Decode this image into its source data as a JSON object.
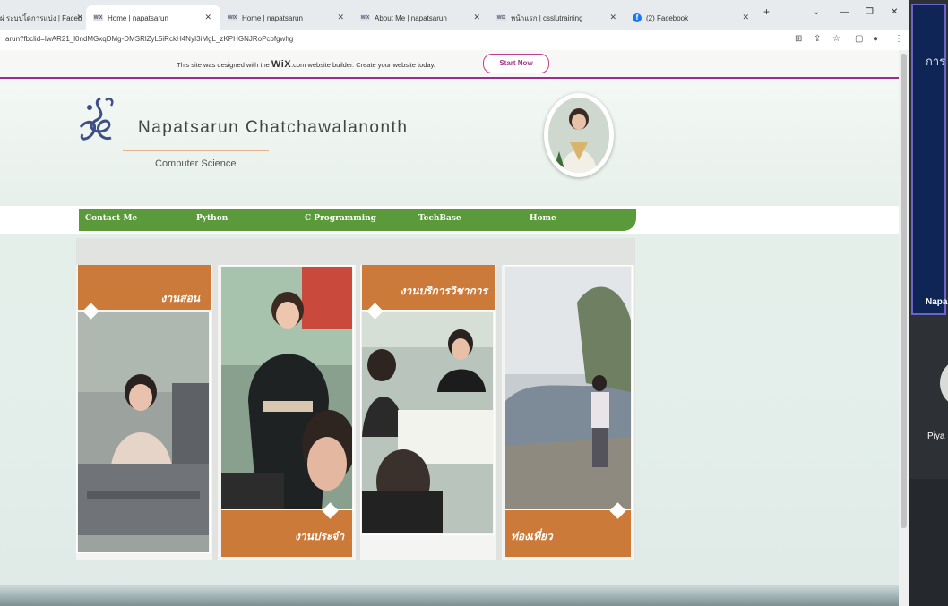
{
  "browser": {
    "tabs": [
      {
        "favicon": "",
        "title": "ผ่ ระบบไ้ดการแบ่ง | Faceb",
        "active": false
      },
      {
        "favicon": "WIX",
        "title": "Home | napatsarun",
        "active": true
      },
      {
        "favicon": "WIX",
        "title": "Home | napatsarun",
        "active": false
      },
      {
        "favicon": "WIX",
        "title": "About Me | napatsarun",
        "active": false
      },
      {
        "favicon": "WIX",
        "title": "หน้าแรก | csslutraining",
        "active": false
      },
      {
        "favicon": "f",
        "title": "(2) Facebook",
        "active": false
      }
    ],
    "new_tab": "+",
    "url": "arun?fbclid=IwAR21_l0ndMGxqDMg-DMSRlZyL5iRckH4NyI3iMgL_zKPHGNJRoPcbfgwhg"
  },
  "wix_banner": {
    "text_before": "This site was designed with the",
    "brand": "WiX",
    "text_after": ".com website builder. Create your website today.",
    "button": "Start Now"
  },
  "site": {
    "name": "Napatsarun Chatchawalanonth",
    "subtitle": "Computer Science",
    "nav": [
      "Contact Me",
      "Python",
      "C Programming",
      "TechBase",
      "Home"
    ],
    "accent": "#5a9a3a",
    "gallery_accent": "#cc7a3a"
  },
  "gallery": [
    {
      "label": "งานสอน"
    },
    {
      "label": "งานประจำ"
    },
    {
      "label": "งานบริการวิชาการ"
    },
    {
      "label": "ท่องเที่ยว"
    }
  ],
  "right_panel": {
    "top_text": "การ",
    "participant_1": "Napa",
    "participant_2": "Piya"
  }
}
